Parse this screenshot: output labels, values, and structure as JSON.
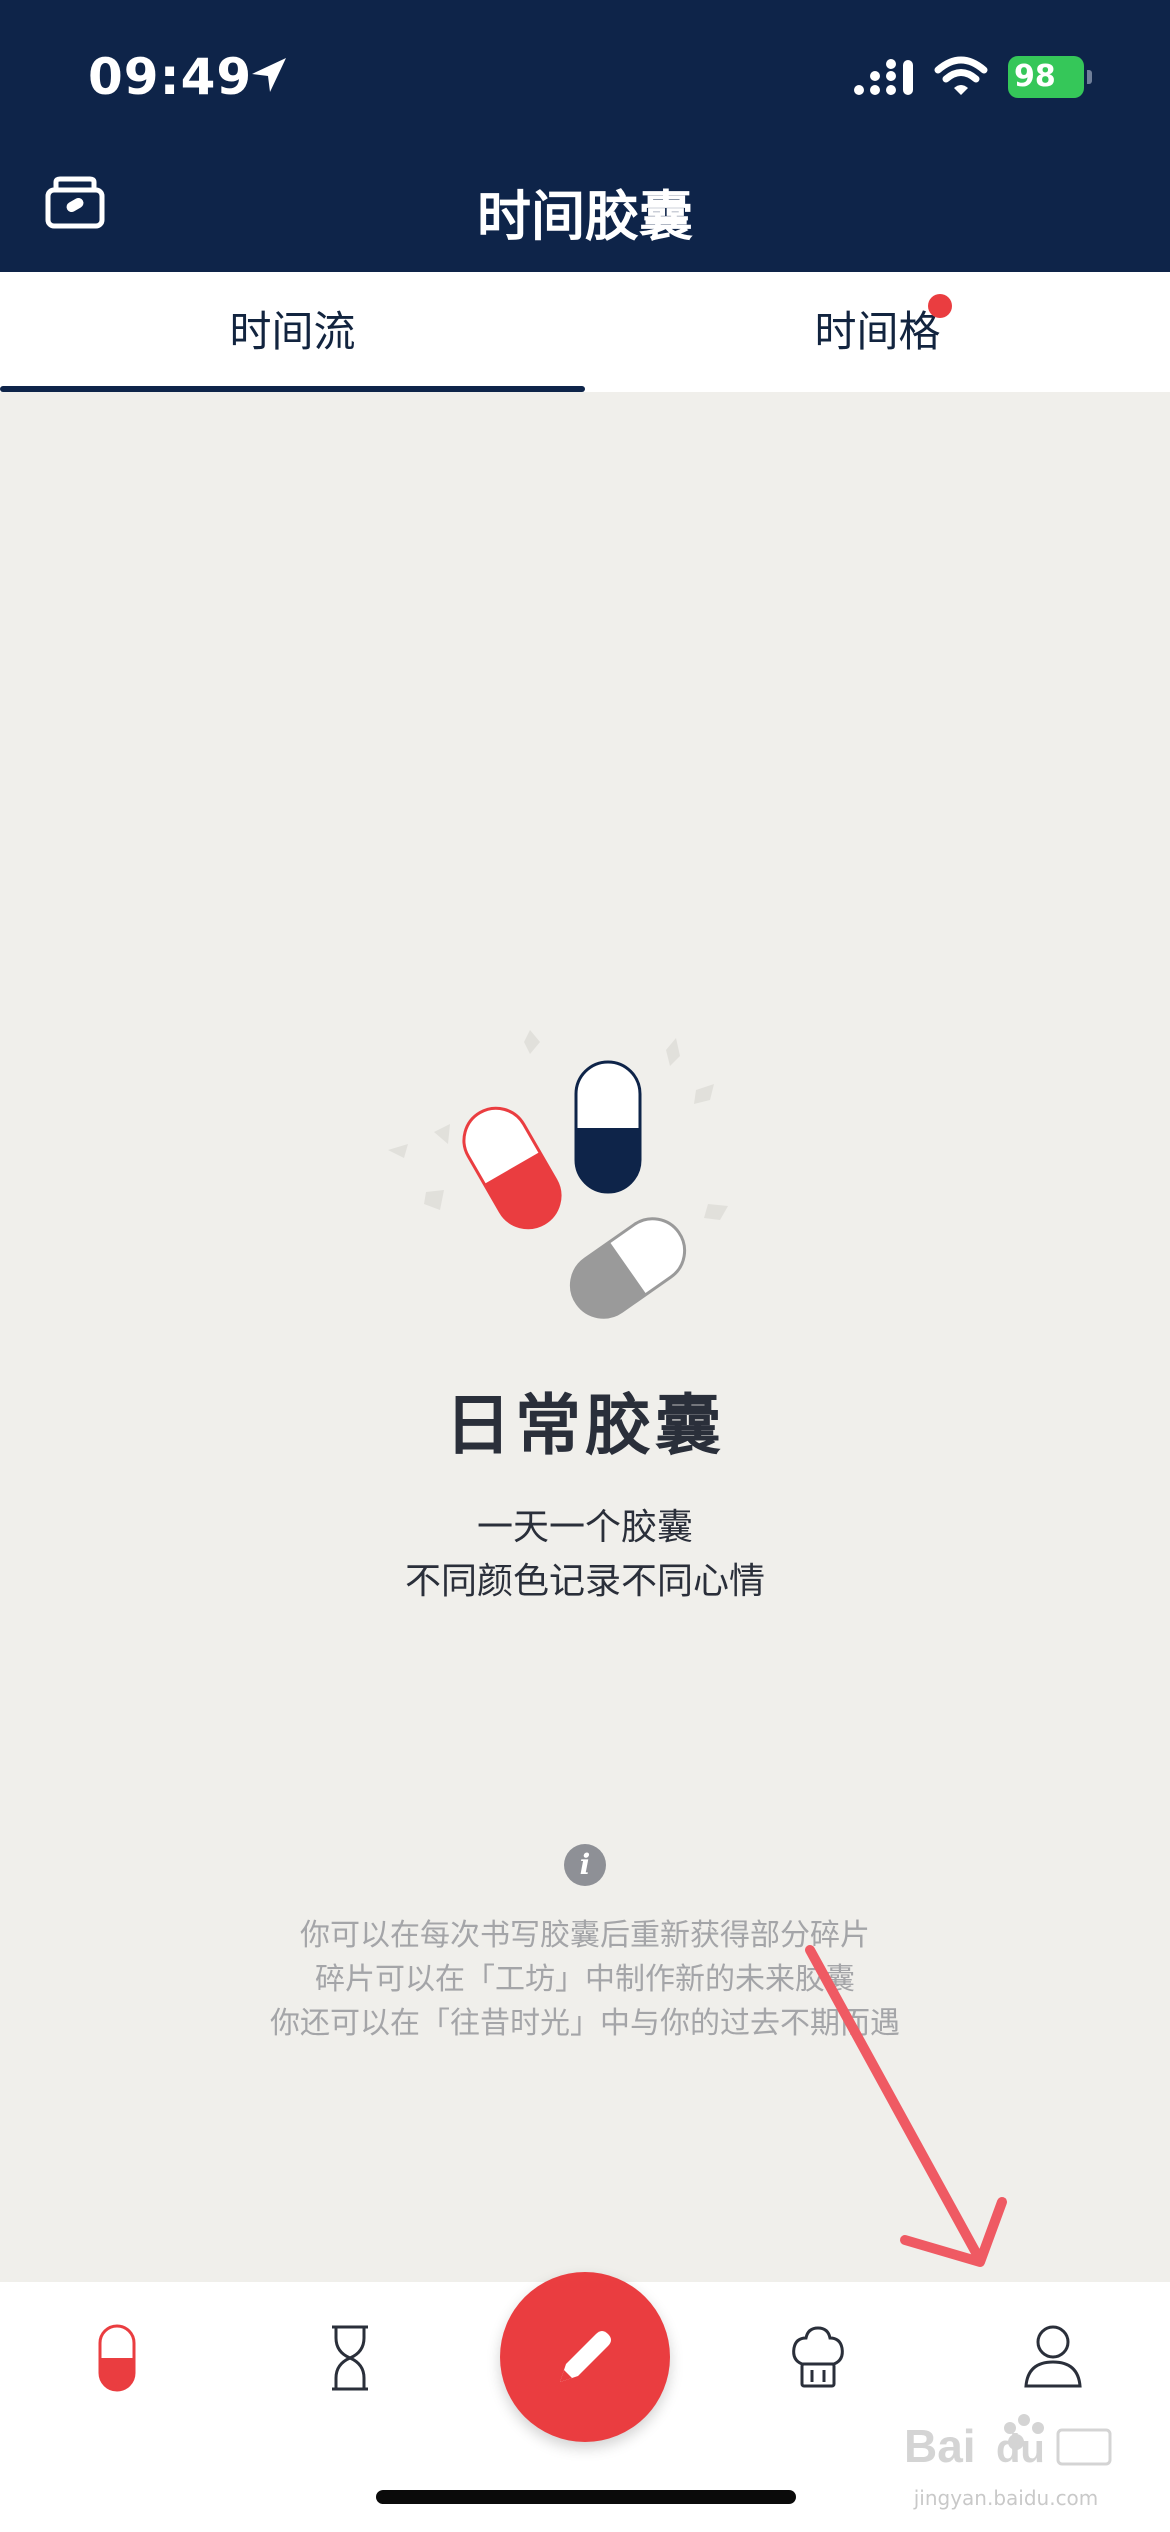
{
  "status_bar": {
    "time": "09:49",
    "battery": "98"
  },
  "header": {
    "title": "时间胶囊"
  },
  "tabs": [
    {
      "label": "时间流",
      "active": true
    },
    {
      "label": "时间格",
      "active": false,
      "badge": true
    }
  ],
  "empty_state": {
    "title": "日常胶囊",
    "lines": [
      "一天一个胶囊",
      "不同颜色记录不同心情"
    ]
  },
  "tips": [
    "你可以在每次书写胶囊后重新获得部分碎片",
    "碎片可以在「工坊」中制作新的未来胶囊",
    "你还可以在「往昔时光」中与你的过去不期而遇"
  ],
  "bottom_nav": {
    "items": [
      "capsule-icon",
      "hourglass-icon",
      "pencil-icon",
      "chef-hat-icon",
      "user-icon"
    ]
  },
  "watermark": {
    "text": "jingyan.baidu.com"
  },
  "colors": {
    "header_bg": "#0e2449",
    "accent_red": "#ea3d40",
    "page_bg": "#f0efeb"
  }
}
